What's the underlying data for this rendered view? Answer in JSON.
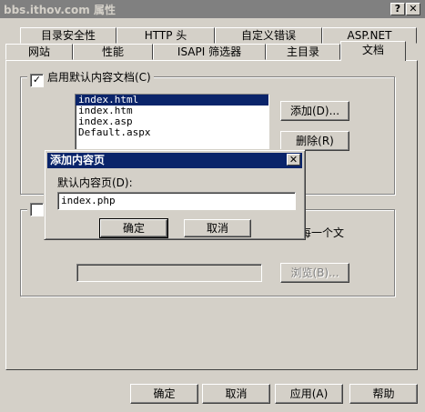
{
  "window": {
    "title": "bbs.ithov.com 属性",
    "help_btn": "?",
    "close_btn": "✕"
  },
  "tabs_row1": [
    "目录安全性",
    "HTTP 头",
    "自定义错误",
    "ASP.NET"
  ],
  "tabs_row2": [
    "网站",
    "性能",
    "ISAPI 筛选器",
    "主目录",
    "文档"
  ],
  "default_doc": {
    "checkbox_label": "启用默认内容文档(C)",
    "checked": true,
    "check_mark": "✓",
    "items": [
      "index.html",
      "index.htm",
      "index.asp",
      "Default.aspx"
    ],
    "selected_index": 0,
    "add_button": "添加(D)...",
    "remove_button": "删除(R)"
  },
  "footer_doc": {
    "partial_text": "每一个文",
    "browse_button": "浏览(B)...",
    "path_value": ""
  },
  "dialog": {
    "title": "添加内容页",
    "close_btn": "✕",
    "label": "默认内容页(D):",
    "input_value": "index.php",
    "ok_button": "确定",
    "cancel_button": "取消"
  },
  "bottom_buttons": {
    "ok": "确定",
    "cancel": "取消",
    "apply": "应用(A)",
    "help": "帮助"
  }
}
